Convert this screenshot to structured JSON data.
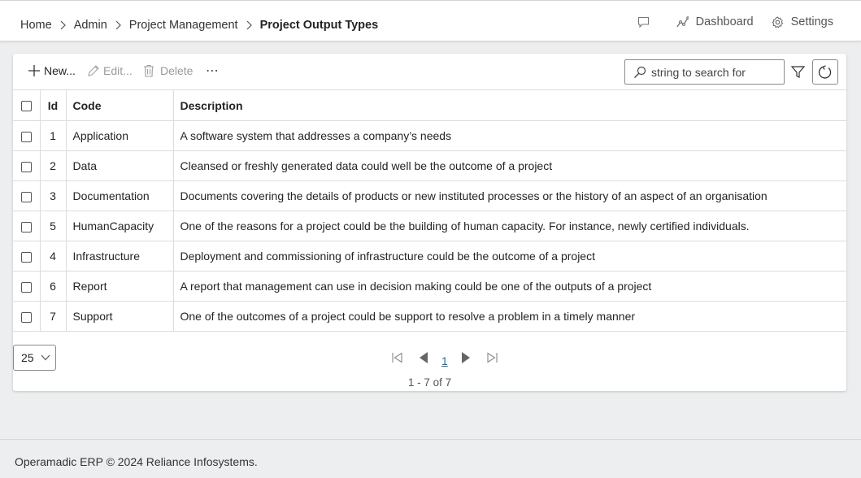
{
  "breadcrumb": [
    "Home",
    "Admin",
    "Project Management",
    "Project Output Types"
  ],
  "header": {
    "dashboard_label": "Dashboard",
    "settings_label": "Settings"
  },
  "toolbar": {
    "new_label": "New...",
    "edit_label": "Edit...",
    "delete_label": "Delete",
    "more_label": "⋯"
  },
  "search": {
    "placeholder": "string to search for",
    "value": ""
  },
  "table": {
    "columns": [
      "Id",
      "Code",
      "Description"
    ],
    "rows": [
      {
        "id": "1",
        "code": "Application",
        "description": "A software system that addresses a company’s needs"
      },
      {
        "id": "2",
        "code": "Data",
        "description": "Cleansed or freshly generated data could well be the outcome of a project"
      },
      {
        "id": "3",
        "code": "Documentation",
        "description": "Documents covering the details of products or new instituted processes or the history of an aspect of an organisation"
      },
      {
        "id": "5",
        "code": "HumanCapacity",
        "description": "One of the reasons for a project could be the building of human capacity. For instance, newly certified individuals."
      },
      {
        "id": "4",
        "code": "Infrastructure",
        "description": "Deployment and commissioning of infrastructure could be the outcome of a project"
      },
      {
        "id": "6",
        "code": "Report",
        "description": "A report that management can use in decision making could be one of the outputs of a project"
      },
      {
        "id": "7",
        "code": "Support",
        "description": "One of the outcomes of a project could be support to resolve a problem in a timely manner"
      }
    ]
  },
  "pager": {
    "page_size": "25",
    "current_page": "1",
    "info": "1 - 7 of 7"
  },
  "footer": {
    "text": "Operamadic ERP © 2024 Reliance Infosystems."
  },
  "colors": {
    "link": "#1a6fa3",
    "background": "#eceeef"
  }
}
